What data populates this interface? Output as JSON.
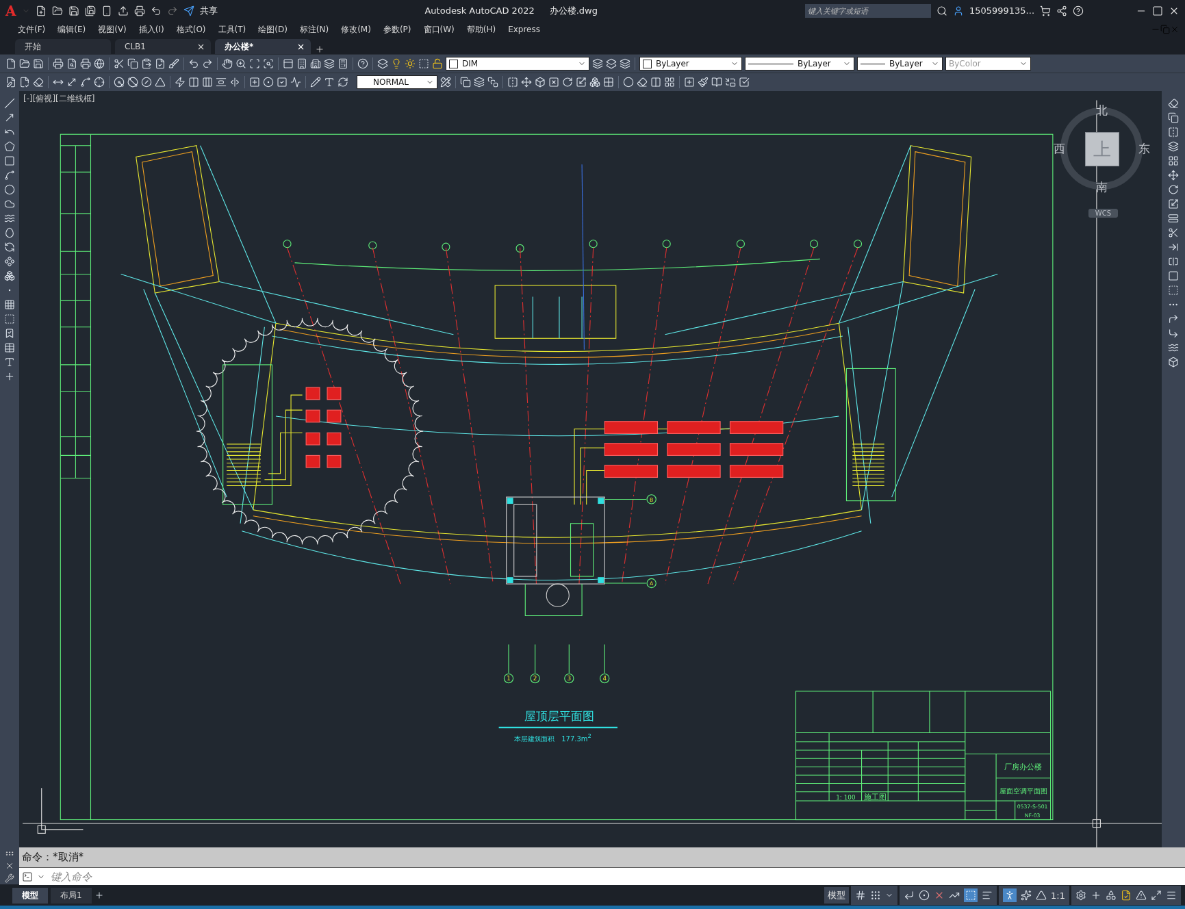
{
  "title_bar": {
    "logo": "A",
    "share": "共享",
    "app_title": "Autodesk AutoCAD 2022",
    "file_name": "办公楼.dwg",
    "search": {
      "placeholder": "键入关键字或短语"
    },
    "user": "1505999135..."
  },
  "menu": [
    "文件(F)",
    "编辑(E)",
    "视图(V)",
    "插入(I)",
    "格式(O)",
    "工具(T)",
    "绘图(D)",
    "标注(N)",
    "修改(M)",
    "参数(P)",
    "窗口(W)",
    "帮助(H)",
    "Express"
  ],
  "tabs": [
    {
      "label": "开始",
      "selected": false,
      "closable": false
    },
    {
      "label": "CLB1",
      "selected": false,
      "closable": true
    },
    {
      "label": "办公楼*",
      "selected": true,
      "closable": true
    }
  ],
  "toolbar": {
    "layer": "DIM",
    "dim_style": "NORMAL",
    "properties": [
      {
        "kind": "color",
        "value": "ByLayer",
        "disabled": false
      },
      {
        "kind": "linetype",
        "value": "ByLayer",
        "disabled": false
      },
      {
        "kind": "lineweight",
        "value": "ByLayer",
        "disabled": false
      },
      {
        "kind": "plain",
        "value": "ByColor",
        "disabled": true
      }
    ]
  },
  "viewport_label": "[-][俯视][二维线框]",
  "viewcube": {
    "north": "北",
    "south": "南",
    "east": "东",
    "west": "西",
    "face": "上",
    "ucs": "WCS"
  },
  "drawing": {
    "title": "屋顶层平面图",
    "area": "本层建筑面积　177.3m$^{2}$",
    "axes": [
      "1",
      "2",
      "3",
      "4"
    ],
    "rows": [
      "B",
      "A"
    ],
    "title_block": {
      "project": "厂房办公楼",
      "sheet_title": "屋面空调平面图",
      "scale": "1: 100",
      "stage": "施工图",
      "drawing_no": "0537-S-501",
      "sheet_no": "NF-03"
    }
  },
  "command": {
    "history": "命令：*取消*",
    "placeholder": "键入命令"
  },
  "layout_tabs": [
    {
      "label": "模型",
      "selected": true
    },
    {
      "label": "布局1",
      "selected": false
    }
  ],
  "status": {
    "space": "模型",
    "scale": "1:1"
  }
}
